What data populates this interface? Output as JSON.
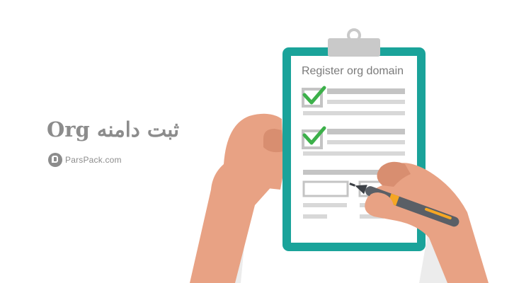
{
  "headline": "ثبت دامنه Org",
  "brand": {
    "name": "ParsPack.com",
    "logo": "parspack-logo-icon"
  },
  "clipboard": {
    "title": "Register org domain"
  },
  "colors": {
    "board_border": "#1aa39a",
    "paper": "#ffffff",
    "check": "#3cb04a",
    "skin": "#e8a284",
    "skin_dark": "#d88e70",
    "pen_body": "#5a5f66",
    "pen_accent": "#f5a623",
    "text_gray": "#8c8c8c"
  }
}
